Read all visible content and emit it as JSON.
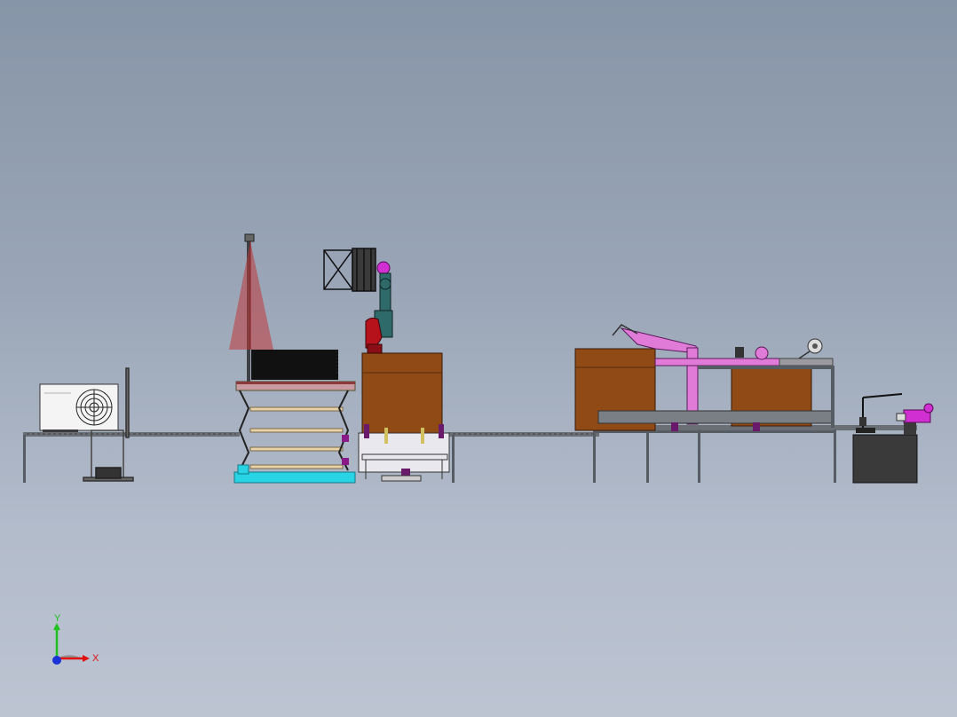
{
  "view": {
    "background_top": "#8795a8",
    "background_bottom": "#bcc4d2"
  },
  "colors": {
    "frame": "#555c63",
    "conveyor": "#6a6f75",
    "wood": "#8f4a16",
    "wood_dark": "#6d3510",
    "black_stack": "#111111",
    "robot_red": "#b5121b",
    "robot_pink": "#d12fd1",
    "robot_teal": "#2f6a6a",
    "laser_cone": "#c0393b",
    "lift_cyan": "#28d3e6",
    "press_pink": "#e07bd8",
    "cabinet": "#3a3a3a",
    "unit_white": "#f4f4f4"
  },
  "triad": {
    "x_label": "X",
    "y_label": "Y",
    "x_color": "#e01010",
    "y_color": "#1ec21e",
    "z_color": "#1a33d6"
  }
}
